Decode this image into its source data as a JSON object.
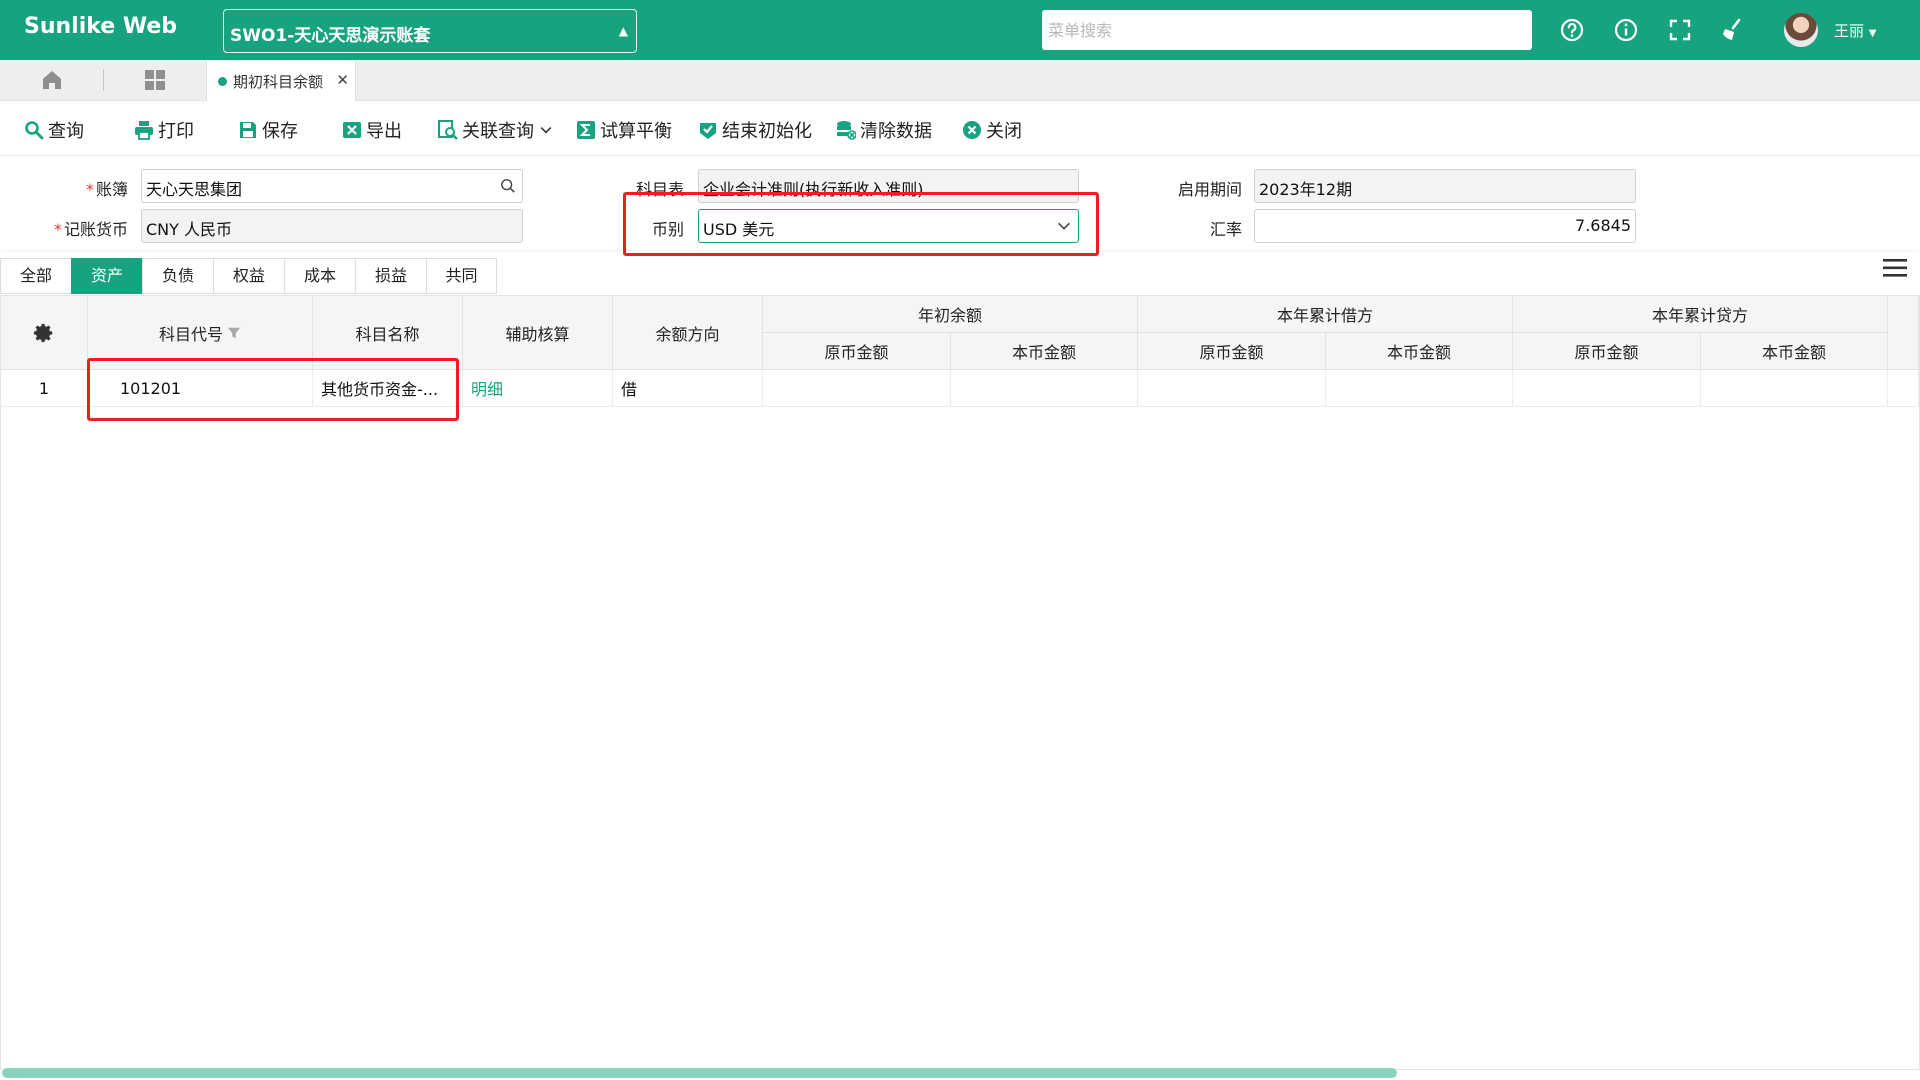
{
  "app": {
    "brand": "Sunlike Web",
    "account_set": "SWO1-天心天思演示账套",
    "menu_search_placeholder": "菜单搜索",
    "username": "王丽",
    "accent": "#17a37f"
  },
  "tabs": {
    "active_label": "期初科目余额"
  },
  "toolbar": {
    "query": "查询",
    "print": "打印",
    "save": "保存",
    "export": "导出",
    "related_query": "关联查询",
    "trial_balance": "试算平衡",
    "finish_init": "结束初始化",
    "clear_data": "清除数据",
    "close": "关闭"
  },
  "form": {
    "ledger_label": "账簿",
    "ledger_value": "天心天思集团",
    "chart_label": "科目表",
    "chart_value": "企业会计准则(执行新收入准则)",
    "period_label": "启用期间",
    "period_value": "2023年12期",
    "book_currency_label": "记账货币",
    "book_currency_value": "CNY 人民币",
    "currency_label": "币别",
    "currency_value": "USD 美元",
    "rate_label": "汇率",
    "rate_value": "7.6845"
  },
  "category_tabs": [
    "全部",
    "资产",
    "负债",
    "权益",
    "成本",
    "损益",
    "共同"
  ],
  "grid": {
    "headers": {
      "code": "科目代号",
      "name": "科目名称",
      "aux": "辅助核算",
      "direction": "余额方向",
      "group_opening": "年初余额",
      "group_debit": "本年累计借方",
      "group_credit": "本年累计贷方",
      "orig_amount": "原币金额",
      "local_amount": "本币金额"
    },
    "rows": [
      {
        "index": "1",
        "code": "101201",
        "name": "其他货币资金-...",
        "aux": "明细",
        "direction": "借"
      }
    ]
  }
}
